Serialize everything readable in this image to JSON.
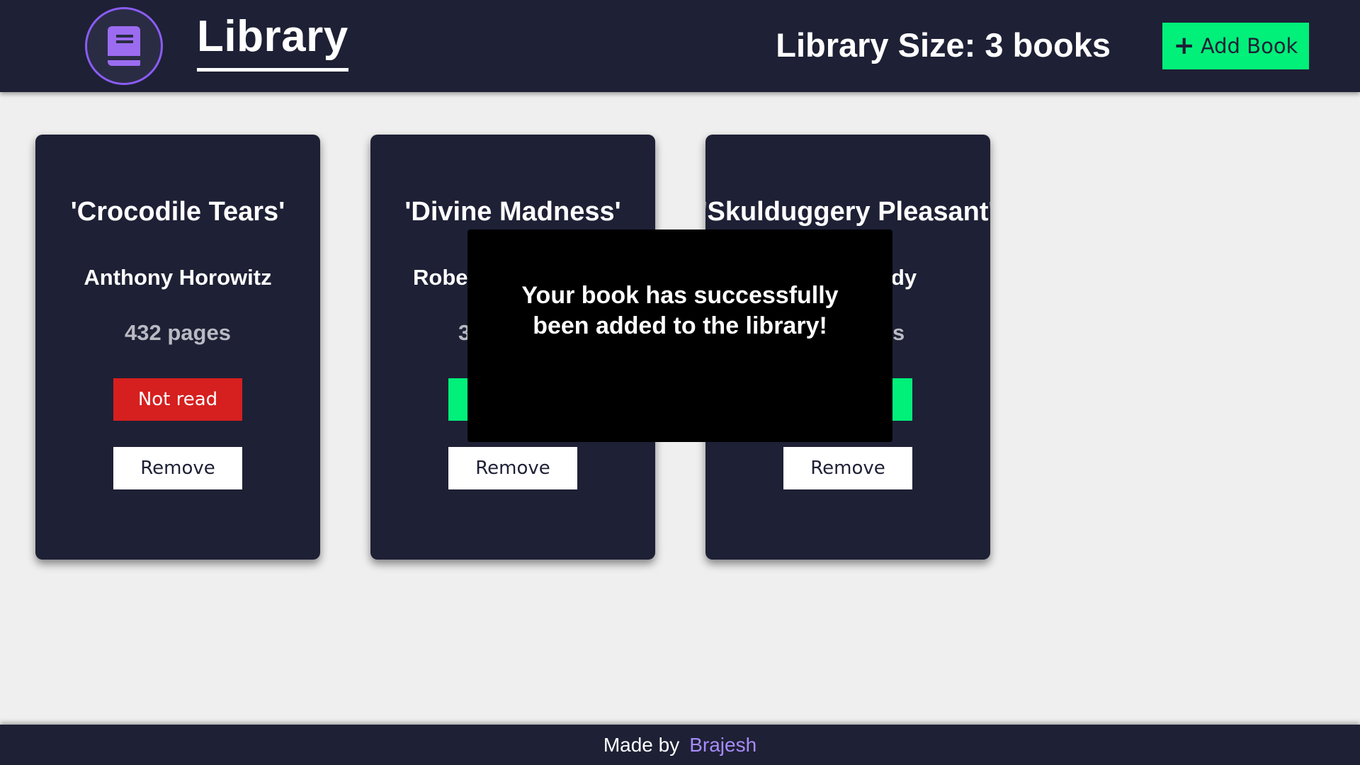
{
  "header": {
    "logo_icon": "book-icon",
    "title": "Library",
    "library_size": "Library Size: 3 books",
    "add_button_label": "Add Book",
    "add_button_icon": "plus-icon"
  },
  "books": [
    {
      "title": "'Crocodile Tears'",
      "author": "Anthony Horowitz",
      "pages": "432 pages",
      "status_label": "Not read",
      "status_color": "#d61f1f",
      "remove_label": "Remove"
    },
    {
      "title": "'Divine Madness'",
      "author": "Robe",
      "pages": "3",
      "status_label": "",
      "status_color": "#00f07a",
      "remove_label": "Remove"
    },
    {
      "title": "'Skulduggery Pleasant'",
      "author": "dy",
      "pages": "s",
      "status_label": "",
      "status_color": "#00f07a",
      "remove_label": "Remove"
    }
  ],
  "toast": {
    "message": "Your book has successfully been added to the library!"
  },
  "footer": {
    "made_by": "Made by",
    "author": "Brajesh"
  },
  "colors": {
    "navy": "#1e2035",
    "accent_green": "#00f07a",
    "accent_purple": "#8b5cf6",
    "not_read_red": "#d61f1f"
  }
}
